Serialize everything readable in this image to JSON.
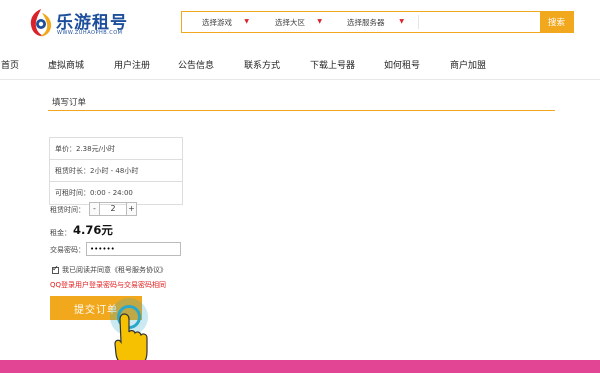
{
  "logo": {
    "title": "乐游租号",
    "subtitle": "WWW.ZUHAOPHB.COM"
  },
  "search": {
    "select_game": "选择游戏",
    "select_region": "选择大区",
    "select_server": "选择服务器",
    "input_value": "",
    "button": "搜索"
  },
  "nav": [
    {
      "label": "首页"
    },
    {
      "label": "虚拟商城"
    },
    {
      "label": "用户注册"
    },
    {
      "label": "公告信息"
    },
    {
      "label": "联系方式"
    },
    {
      "label": "下载上号器"
    },
    {
      "label": "如何租号"
    },
    {
      "label": "商户加盟"
    }
  ],
  "order": {
    "section_title": "填写订单",
    "unit_price": "单价：2.38元/小时",
    "rent_duration": "租赁时长：2小时 - 48小时",
    "available_time": "可租时间：0:00 - 24:00",
    "rent_time_label": "租赁时间：",
    "rent_time_value": "2",
    "minus": "-",
    "plus": "+",
    "deposit_label": "租金：",
    "deposit_value": "4.76元",
    "password_label": "交易密码：",
    "password_value": "••••••",
    "agree_text": "我已阅读并同意《租号服务协议》",
    "notice": "QQ登录用户登录密码与交易密码相同",
    "submit": "提交订单"
  },
  "colors": {
    "accent": "#f2a81d",
    "brand_blue": "#1e4f9c",
    "alert_red": "#e21f1f",
    "bottom_bar": "#e24593",
    "tap_ring": "#2aa7c9",
    "hand": "#f5c100"
  }
}
